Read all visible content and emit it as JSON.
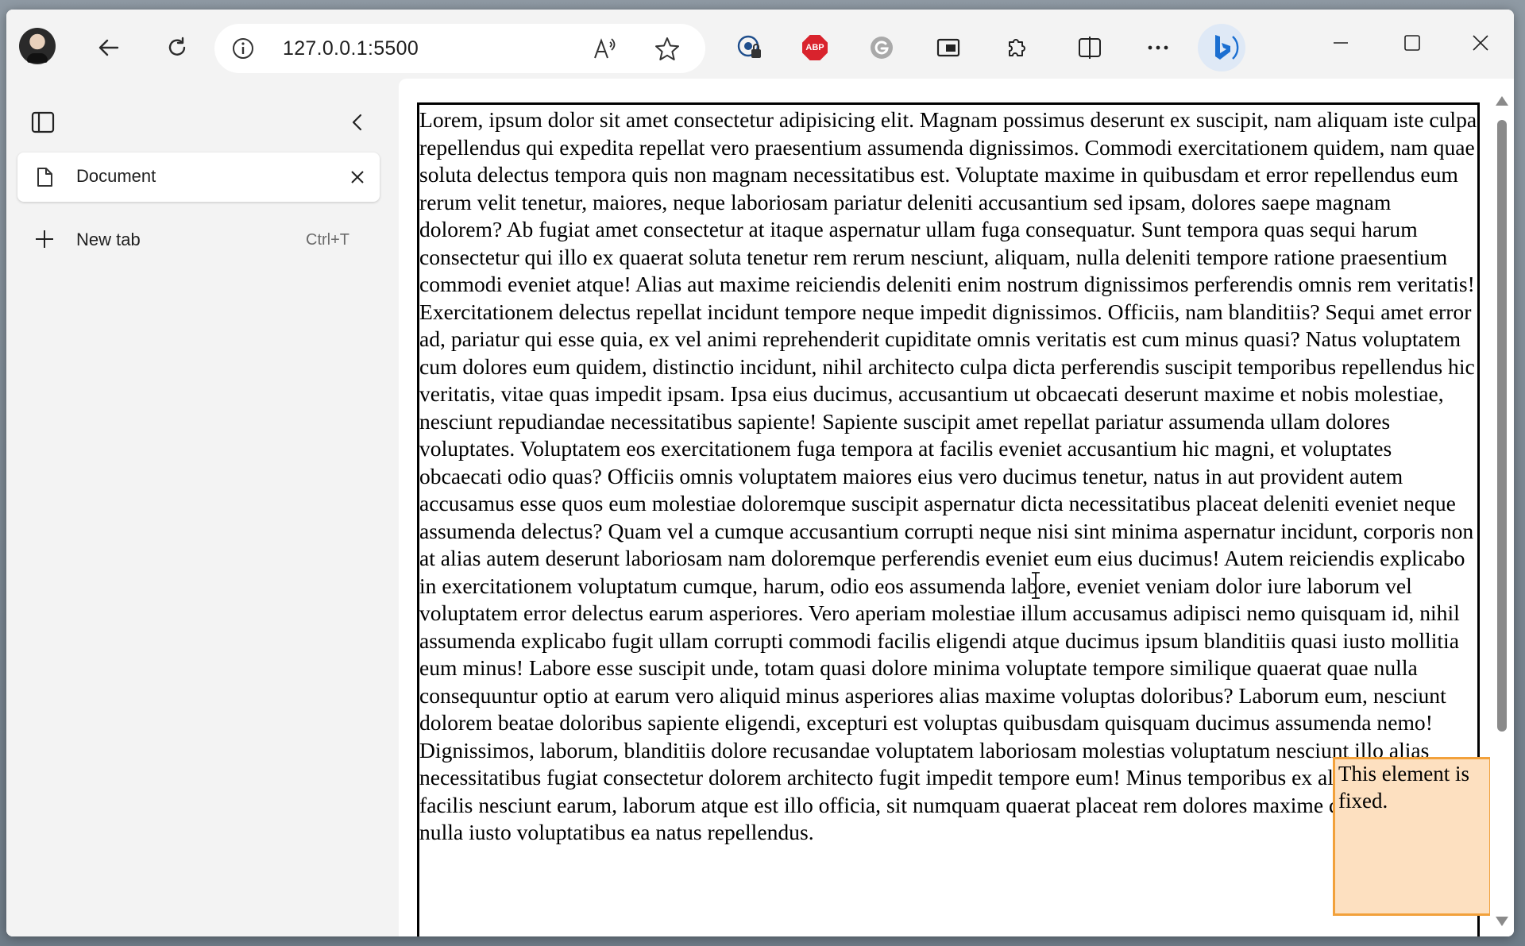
{
  "browser": {
    "address": "127.0.0.1:5500",
    "icons": {
      "profile": "avatar",
      "back": "back-arrow-icon",
      "refresh": "refresh-icon",
      "site_info": "info-icon",
      "read_aloud": "read-aloud-icon",
      "favorite": "star-icon",
      "extensions": [
        "privacy-extension-icon",
        "adblock-plus-icon",
        "grammarly-icon",
        "picture-in-picture-icon",
        "extensions-puzzle-icon",
        "split-screen-icon",
        "more-icon",
        "bing-copilot-icon"
      ]
    },
    "abp_label": "ABP"
  },
  "sidebar": {
    "tabs": [
      {
        "label": "Document",
        "active": true
      }
    ],
    "new_tab": {
      "label": "New tab",
      "shortcut": "Ctrl+T"
    }
  },
  "page": {
    "body_text": "Lorem, ipsum dolor sit amet consectetur adipisicing elit. Magnam possimus deserunt ex suscipit, nam aliquam iste culpa repellendus qui expedita repellat vero praesentium assumenda dignissimos. Commodi exercitationem quidem, nam quae soluta delectus tempora quis non magnam necessitatibus est. Voluptate maxime in quibusdam et error repellendus eum rerum velit tenetur, maiores, neque laboriosam pariatur deleniti accusantium sed ipsam, dolores saepe magnam dolorem? Ab fugiat amet consectetur at itaque aspernatur ullam fuga consequatur. Sunt tempora quas sequi harum consectetur qui illo ex quaerat soluta tenetur rem rerum nesciunt, aliquam, nulla deleniti tempore ratione praesentium commodi eveniet atque! Alias aut maxime reiciendis deleniti enim nostrum dignissimos perferendis omnis rem veritatis! Exercitationem delectus repellat incidunt tempore neque impedit dignissimos. Officiis, nam blanditiis? Sequi amet error ad, pariatur qui esse quia, ex vel animi reprehenderit cupiditate omnis veritatis est cum minus quasi? Natus voluptatem cum dolores eum quidem, distinctio incidunt, nihil architecto culpa dicta perferendis suscipit temporibus repellendus hic veritatis, vitae quas impedit ipsam. Ipsa eius ducimus, accusantium ut obcaecati deserunt maxime et nobis molestiae, nesciunt repudiandae necessitatibus sapiente! Sapiente suscipit amet repellat pariatur assumenda ullam dolores voluptates. Voluptatem eos exercitationem fuga tempora at facilis eveniet accusantium hic magni, et voluptates obcaecati odio quas? Officiis omnis voluptatem maiores eius vero ducimus tenetur, natus in aut provident autem accusamus esse quos eum molestiae doloremque suscipit aspernatur dicta necessitatibus placeat deleniti eveniet neque assumenda delectus? Quam vel a cumque accusantium corrupti neque nisi sint minima aspernatur incidunt, corporis non at alias autem deserunt laboriosam nam doloremque perferendis eveniet eum eius ducimus! Autem reiciendis explicabo in exercitationem voluptatum cumque, harum, odio eos assumenda labore, eveniet veniam dolor iure laborum vel voluptatem error delectus earum asperiores. Vero aperiam molestiae illum accusamus adipisci nemo quisquam id, nihil assumenda explicabo fugit ullam corrupti commodi facilis eligendi atque ducimus ipsum blanditiis quasi iusto mollitia eum minus! Labore esse suscipit unde, totam quasi dolore minima voluptate tempore similique quaerat quae nulla consequuntur optio at earum vero aliquid minus asperiores alias maxime voluptas doloribus? Laborum eum, nesciunt dolorem beatae doloribus sapiente eligendi, excepturi est voluptas quibusdam quisquam ducimus assumenda nemo! Dignissimos, laborum, blanditiis dolore recusandae voluptatem laboriosam molestias voluptatum nesciunt illo alias necessitatibus fugiat consectetur dolorem architecto fugit impedit tempore eum! Minus temporibus ex alias dignissimos facilis nesciunt earum, laborum atque est illo officia, sit numquam quaerat placeat rem dolores maxime deleniti amet nulla iusto voluptatibus ea natus repellendus.",
    "fixed_note": "This element is fixed."
  },
  "colors": {
    "note_background": "#fde0c0",
    "note_border": "#f2a13b",
    "abp_red": "#d9232d",
    "bing_blue": "#1b6fd1"
  }
}
